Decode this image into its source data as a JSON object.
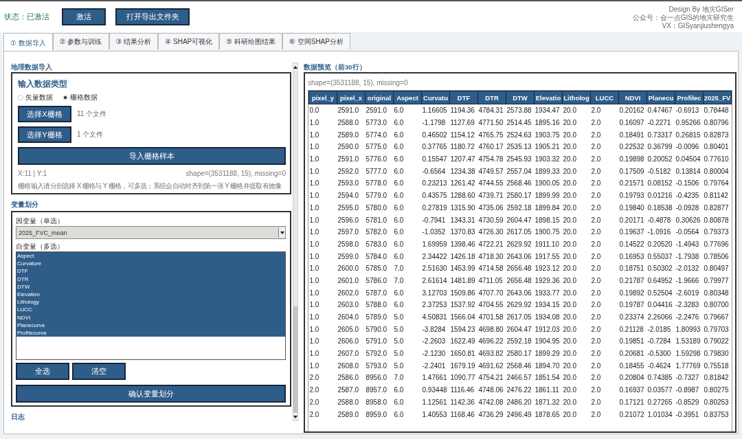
{
  "header": {
    "status": "状态：已激活",
    "buttons": [
      "激活",
      "打开导出文件夹"
    ],
    "credits": [
      "Design By 地灾GISer",
      "公众号：会一点GIS的地灾研究生",
      "VX：GISyanjiushengya"
    ]
  },
  "tabs": [
    {
      "label": "① 数据导入",
      "selected": true
    },
    {
      "label": "② 参数与训练",
      "selected": false
    },
    {
      "label": "③ 结果分析",
      "selected": false
    },
    {
      "label": "④ SHAP可视化",
      "selected": false
    },
    {
      "label": "⑤ 科研绘图结果",
      "selected": false
    },
    {
      "label": "⑥ 空间SHAP分析",
      "selected": false
    }
  ],
  "import_section": {
    "title": "地理数据导入",
    "card_title": "输入数据类型",
    "radios": [
      {
        "label": "矢量数据",
        "selected": false
      },
      {
        "label": "栅格数据",
        "selected": true
      }
    ],
    "file_pickers": [
      {
        "button": "选择X栅格",
        "status": "11 个文件"
      },
      {
        "button": "选择Y栅格",
        "status": "1 个文件"
      }
    ],
    "import_button": "导入栅格样本",
    "counts": "X:11 | Y:1",
    "shape": "shape=(3531188, 15), missing=0",
    "note": "栅格输入请分别选择 X 栅格与 Y 栅格，可多选；系统会自动对齐到第一张 Y 栅格并提取有效像"
  },
  "variables_section": {
    "title": "变量划分",
    "dependent_label": "因变量（单选）",
    "dependent_value": "2025_FVC_mean",
    "independent_label": "自变量（多选）",
    "independent": [
      {
        "label": "Aspect",
        "selected": true
      },
      {
        "label": "Curvature",
        "selected": true
      },
      {
        "label": "DTF",
        "selected": true
      },
      {
        "label": "DTR",
        "selected": true
      },
      {
        "label": "DTW",
        "selected": true
      },
      {
        "label": "Elevation",
        "selected": true
      },
      {
        "label": "Lithology",
        "selected": true
      },
      {
        "label": "LUCC",
        "selected": true
      },
      {
        "label": "NDVI",
        "selected": true
      },
      {
        "label": "Planecurva",
        "selected": true
      },
      {
        "label": "Profilecurva",
        "selected": true
      }
    ],
    "buttons": [
      "全选",
      "清空"
    ],
    "confirm_button": "确认变量划分"
  },
  "log_section": {
    "title": "日志"
  },
  "preview": {
    "title": "数据预览（前30行）",
    "shape": "shape=(3531188, 15), missing=0",
    "columns": [
      "pixel_y",
      "pixel_x",
      "original",
      "Aspect",
      "Curvatu",
      "DTF",
      "DTR",
      "DTW",
      "Elevatio",
      "Litholog",
      "LUCC",
      "NDVI",
      "Planecu",
      "Profilec",
      "2025_FV"
    ],
    "rows": [
      [
        "0.0",
        "2591.0",
        "2591.0",
        "6.0",
        "1.16605",
        "1194.36",
        "4784.31",
        "2573.88",
        "1934.47",
        "20.0",
        "2.0",
        "0.20162",
        "0.47467",
        "-0.6913",
        "0.78448"
      ],
      [
        "1.0",
        "2588.0",
        "5773.0",
        "6.0",
        "-1.1798",
        "1127.69",
        "4771.50",
        "2514.45",
        "1895.16",
        "20.0",
        "2.0",
        "0.16097",
        "-0.2271",
        "0.95266",
        "0.80796"
      ],
      [
        "1.0",
        "2589.0",
        "5774.0",
        "6.0",
        "0.46502",
        "1154.12",
        "4765.75",
        "2524.63",
        "1903.75",
        "20.0",
        "2.0",
        "0.18491",
        "0.73317",
        "0.26815",
        "0.82873"
      ],
      [
        "1.0",
        "2590.0",
        "5775.0",
        "6.0",
        "0.37765",
        "1180.72",
        "4760.17",
        "2535.13",
        "1905.21",
        "20.0",
        "2.0",
        "0.22532",
        "0.36799",
        "-0.0096",
        "0.80401"
      ],
      [
        "1.0",
        "2591.0",
        "5776.0",
        "6.0",
        "0.15547",
        "1207.47",
        "4754.78",
        "2545.93",
        "1903.32",
        "20.0",
        "2.0",
        "0.19898",
        "0.20052",
        "0.04504",
        "0.77610"
      ],
      [
        "1.0",
        "2592.0",
        "5777.0",
        "6.0",
        "-0.6564",
        "1234.38",
        "4749.57",
        "2557.04",
        "1899.33",
        "20.0",
        "2.0",
        "0.17509",
        "-0.5182",
        "0.13814",
        "0.80004"
      ],
      [
        "1.0",
        "2593.0",
        "5778.0",
        "6.0",
        "0.23213",
        "1261.42",
        "4744.55",
        "2568.46",
        "1900.05",
        "20.0",
        "2.0",
        "0.21571",
        "0.08152",
        "-0.1506",
        "0.79764"
      ],
      [
        "1.0",
        "2594.0",
        "5779.0",
        "6.0",
        "0.43575",
        "1288.60",
        "4739.71",
        "2580.17",
        "1899.99",
        "20.0",
        "2.0",
        "0.19793",
        "0.01216",
        "-0.4235",
        "0.81142"
      ],
      [
        "1.0",
        "2595.0",
        "5780.0",
        "6.0",
        "0.27819",
        "1315.90",
        "4735.06",
        "2592.18",
        "1899.84",
        "20.0",
        "2.0",
        "0.19840",
        "0.18538",
        "-0.0928",
        "0.82877"
      ],
      [
        "1.0",
        "2596.0",
        "5781.0",
        "6.0",
        "-0.7941",
        "1343.31",
        "4730.59",
        "2604.47",
        "1898.15",
        "20.0",
        "2.0",
        "0.20171",
        "-0.4878",
        "0.30626",
        "0.80878"
      ],
      [
        "1.0",
        "2597.0",
        "5782.0",
        "6.0",
        "-1.0352",
        "1370.83",
        "4726.30",
        "2617.05",
        "1900.75",
        "20.0",
        "2.0",
        "0.19637",
        "-1.0916",
        "-0.0564",
        "0.79373"
      ],
      [
        "1.0",
        "2598.0",
        "5783.0",
        "6.0",
        "1.69959",
        "1398.46",
        "4722.21",
        "2629.92",
        "1911.10",
        "20.0",
        "2.0",
        "0.14522",
        "0.20520",
        "-1.4943",
        "0.77696"
      ],
      [
        "1.0",
        "2599.0",
        "5784.0",
        "6.0",
        "2.34422",
        "1426.18",
        "4718.30",
        "2643.06",
        "1917.55",
        "20.0",
        "2.0",
        "0.16953",
        "0.55037",
        "-1.7938",
        "0.78506"
      ],
      [
        "1.0",
        "2600.0",
        "5785.0",
        "7.0",
        "2.51630",
        "1453.99",
        "4714.58",
        "2656.48",
        "1923.12",
        "20.0",
        "2.0",
        "0.18751",
        "0.50302",
        "-2.0132",
        "0.80497"
      ],
      [
        "1.0",
        "2601.0",
        "5786.0",
        "7.0",
        "2.61614",
        "1481.89",
        "4711.05",
        "2656.48",
        "1929.36",
        "20.0",
        "2.0",
        "0.21787",
        "0.64952",
        "-1.9666",
        "0.79977"
      ],
      [
        "1.0",
        "2602.0",
        "5787.0",
        "6.0",
        "3.12703",
        "1509.86",
        "4707.70",
        "2643.06",
        "1933.77",
        "20.0",
        "2.0",
        "0.19892",
        "0.52504",
        "-2.6019",
        "0.80348"
      ],
      [
        "1.0",
        "2603.0",
        "5788.0",
        "6.0",
        "2.37253",
        "1537.92",
        "4704.55",
        "2629.92",
        "1934.15",
        "20.0",
        "2.0",
        "0.19787",
        "0.04416",
        "-2.3283",
        "0.80700"
      ],
      [
        "1.0",
        "2604.0",
        "5789.0",
        "5.0",
        "4.50831",
        "1566.04",
        "4701.58",
        "2617.05",
        "1934.08",
        "20.0",
        "2.0",
        "0.23374",
        "2.26066",
        "-2.2476",
        "0.79667"
      ],
      [
        "1.0",
        "2605.0",
        "5790.0",
        "5.0",
        "-3.8284",
        "1594.23",
        "4698.80",
        "2604.47",
        "1912.03",
        "20.0",
        "2.0",
        "0.21128",
        "-2.0185",
        "1.80993",
        "0.79703"
      ],
      [
        "1.0",
        "2606.0",
        "5791.0",
        "5.0",
        "-2.2603",
        "1622.49",
        "4696.22",
        "2592.18",
        "1904.95",
        "20.0",
        "2.0",
        "0.19851",
        "-0.7284",
        "1.53189",
        "0.79022"
      ],
      [
        "1.0",
        "2607.0",
        "5792.0",
        "5.0",
        "-2.1230",
        "1650.81",
        "4693.82",
        "2580.17",
        "1899.29",
        "20.0",
        "2.0",
        "0.20681",
        "-0.5300",
        "1.59298",
        "0.79830"
      ],
      [
        "1.0",
        "2608.0",
        "5793.0",
        "5.0",
        "-2.2401",
        "1679.19",
        "4691.62",
        "2568.46",
        "1894.70",
        "20.0",
        "2.0",
        "0.18455",
        "-0.4624",
        "1.77769",
        "0.75518"
      ],
      [
        "2.0",
        "2586.0",
        "8956.0",
        "7.0",
        "1.47661",
        "1090.77",
        "4754.21",
        "2466.57",
        "1851.54",
        "20.0",
        "2.0",
        "0.20804",
        "0.74385",
        "-0.7327",
        "0.81842"
      ],
      [
        "2.0",
        "2587.0",
        "8957.0",
        "6.0",
        "0.93448",
        "1116.46",
        "4748.06",
        "2476.22",
        "1861.11",
        "20.0",
        "2.0",
        "0.16937",
        "0.03577",
        "-0.8987",
        "0.80275"
      ],
      [
        "2.0",
        "2588.0",
        "8958.0",
        "6.0",
        "1.12561",
        "1142.36",
        "4742.08",
        "2486.20",
        "1871.32",
        "20.0",
        "2.0",
        "0.17121",
        "0.27265",
        "-0.8529",
        "0.80253"
      ],
      [
        "2.0",
        "2589.0",
        "8959.0",
        "6.0",
        "1.40553",
        "1168.46",
        "4736.29",
        "2496.49",
        "1878.65",
        "20.0",
        "2.0",
        "0.21072",
        "1.01034",
        "-0.3951",
        "0.83753"
      ]
    ]
  }
}
